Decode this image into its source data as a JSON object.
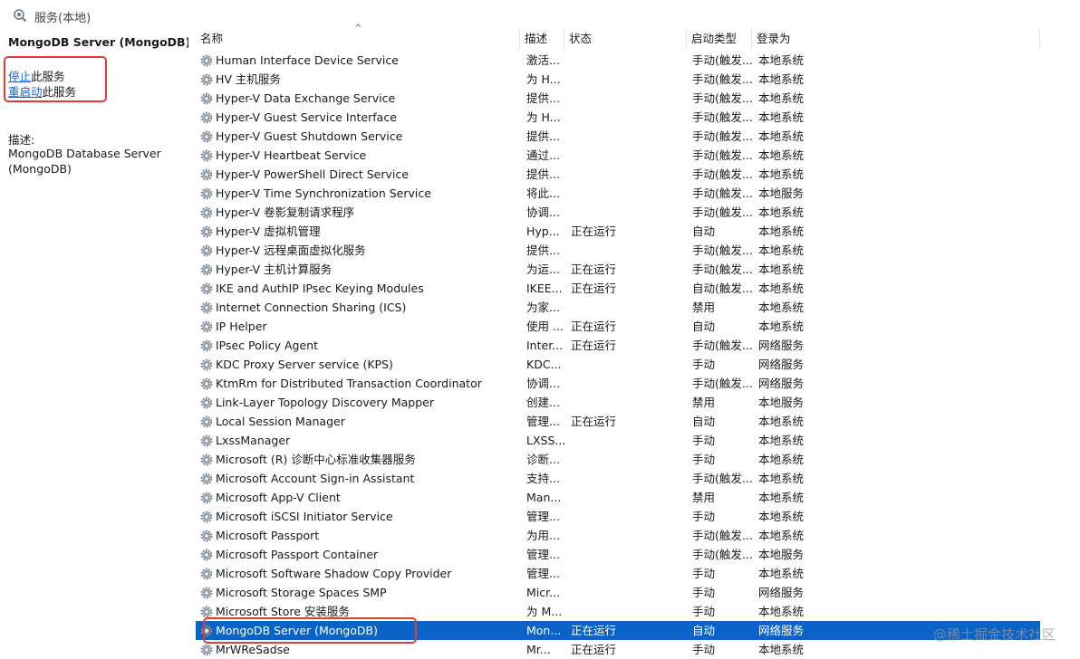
{
  "window": {
    "title": "服务(本地)"
  },
  "left_pane": {
    "service_title": "MongoDB Server (MongoDB)",
    "stop_link": "停止",
    "stop_suffix": "此服务",
    "restart_link": "重启动",
    "restart_suffix": "此服务",
    "description_label": "描述:",
    "description_text": "MongoDB Database Server (MongoDB)"
  },
  "columns": {
    "name": "名称",
    "description": "描述",
    "status": "状态",
    "startup_type": "启动类型",
    "logon_as": "登录为"
  },
  "services": [
    {
      "name": "Human Interface Device Service",
      "desc": "激活...",
      "status": "",
      "startup": "手动(触发...",
      "logon": "本地系统"
    },
    {
      "name": "HV 主机服务",
      "desc": "为 H...",
      "status": "",
      "startup": "手动(触发...",
      "logon": "本地系统"
    },
    {
      "name": "Hyper-V Data Exchange Service",
      "desc": "提供...",
      "status": "",
      "startup": "手动(触发...",
      "logon": "本地系统"
    },
    {
      "name": "Hyper-V Guest Service Interface",
      "desc": "为 H...",
      "status": "",
      "startup": "手动(触发...",
      "logon": "本地系统"
    },
    {
      "name": "Hyper-V Guest Shutdown Service",
      "desc": "提供...",
      "status": "",
      "startup": "手动(触发...",
      "logon": "本地系统"
    },
    {
      "name": "Hyper-V Heartbeat Service",
      "desc": "通过...",
      "status": "",
      "startup": "手动(触发...",
      "logon": "本地系统"
    },
    {
      "name": "Hyper-V PowerShell Direct Service",
      "desc": "提供...",
      "status": "",
      "startup": "手动(触发...",
      "logon": "本地系统"
    },
    {
      "name": "Hyper-V Time Synchronization Service",
      "desc": "将此...",
      "status": "",
      "startup": "手动(触发...",
      "logon": "本地服务"
    },
    {
      "name": "Hyper-V 卷影复制请求程序",
      "desc": "协调...",
      "status": "",
      "startup": "手动(触发...",
      "logon": "本地系统"
    },
    {
      "name": "Hyper-V 虚拟机管理",
      "desc": "Hyp...",
      "status": "正在运行",
      "startup": "自动",
      "logon": "本地系统"
    },
    {
      "name": "Hyper-V 远程桌面虚拟化服务",
      "desc": "提供...",
      "status": "",
      "startup": "手动(触发...",
      "logon": "本地系统"
    },
    {
      "name": "Hyper-V 主机计算服务",
      "desc": "为运...",
      "status": "正在运行",
      "startup": "手动(触发...",
      "logon": "本地系统"
    },
    {
      "name": "IKE and AuthIP IPsec Keying Modules",
      "desc": "IKEE...",
      "status": "正在运行",
      "startup": "自动(触发...",
      "logon": "本地系统"
    },
    {
      "name": "Internet Connection Sharing (ICS)",
      "desc": "为家...",
      "status": "",
      "startup": "禁用",
      "logon": "本地系统"
    },
    {
      "name": "IP Helper",
      "desc": "使用 ...",
      "status": "正在运行",
      "startup": "自动",
      "logon": "本地系统"
    },
    {
      "name": "IPsec Policy Agent",
      "desc": "Inter...",
      "status": "正在运行",
      "startup": "手动(触发...",
      "logon": "网络服务"
    },
    {
      "name": "KDC Proxy Server service (KPS)",
      "desc": "KDC...",
      "status": "",
      "startup": "手动",
      "logon": "网络服务"
    },
    {
      "name": "KtmRm for Distributed Transaction Coordinator",
      "desc": "协调...",
      "status": "",
      "startup": "手动(触发...",
      "logon": "网络服务"
    },
    {
      "name": "Link-Layer Topology Discovery Mapper",
      "desc": "创建...",
      "status": "",
      "startup": "禁用",
      "logon": "本地服务"
    },
    {
      "name": "Local Session Manager",
      "desc": "管理...",
      "status": "正在运行",
      "startup": "自动",
      "logon": "本地系统"
    },
    {
      "name": "LxssManager",
      "desc": "LXSS...",
      "status": "",
      "startup": "手动",
      "logon": "本地系统"
    },
    {
      "name": "Microsoft (R) 诊断中心标准收集器服务",
      "desc": "诊断...",
      "status": "",
      "startup": "手动",
      "logon": "本地系统"
    },
    {
      "name": "Microsoft Account Sign-in Assistant",
      "desc": "支持...",
      "status": "",
      "startup": "手动(触发...",
      "logon": "本地系统"
    },
    {
      "name": "Microsoft App-V Client",
      "desc": "Man...",
      "status": "",
      "startup": "禁用",
      "logon": "本地系统"
    },
    {
      "name": "Microsoft iSCSI Initiator Service",
      "desc": "管理...",
      "status": "",
      "startup": "手动",
      "logon": "本地系统"
    },
    {
      "name": "Microsoft Passport",
      "desc": "为用...",
      "status": "",
      "startup": "手动(触发...",
      "logon": "本地系统"
    },
    {
      "name": "Microsoft Passport Container",
      "desc": "管理...",
      "status": "",
      "startup": "手动(触发...",
      "logon": "本地服务"
    },
    {
      "name": "Microsoft Software Shadow Copy Provider",
      "desc": "管理...",
      "status": "",
      "startup": "手动",
      "logon": "本地系统"
    },
    {
      "name": "Microsoft Storage Spaces SMP",
      "desc": "Micr...",
      "status": "",
      "startup": "手动",
      "logon": "网络服务"
    },
    {
      "name": "Microsoft Store 安装服务",
      "desc": "为 M...",
      "status": "",
      "startup": "手动",
      "logon": "本地系统"
    },
    {
      "name": "MongoDB Server (MongoDB)",
      "desc": "Mon...",
      "status": "正在运行",
      "startup": "自动",
      "logon": "网络服务",
      "selected": true
    },
    {
      "name": "MrWReSadse",
      "desc": "Mr...",
      "status": "正在运行",
      "startup": "手动",
      "logon": "本地系统"
    }
  ],
  "watermark": "@稀土掘金技术社区",
  "colors": {
    "selection": "#0a64c8",
    "highlight_box": "#e03c31",
    "link": "#1a62c6"
  }
}
